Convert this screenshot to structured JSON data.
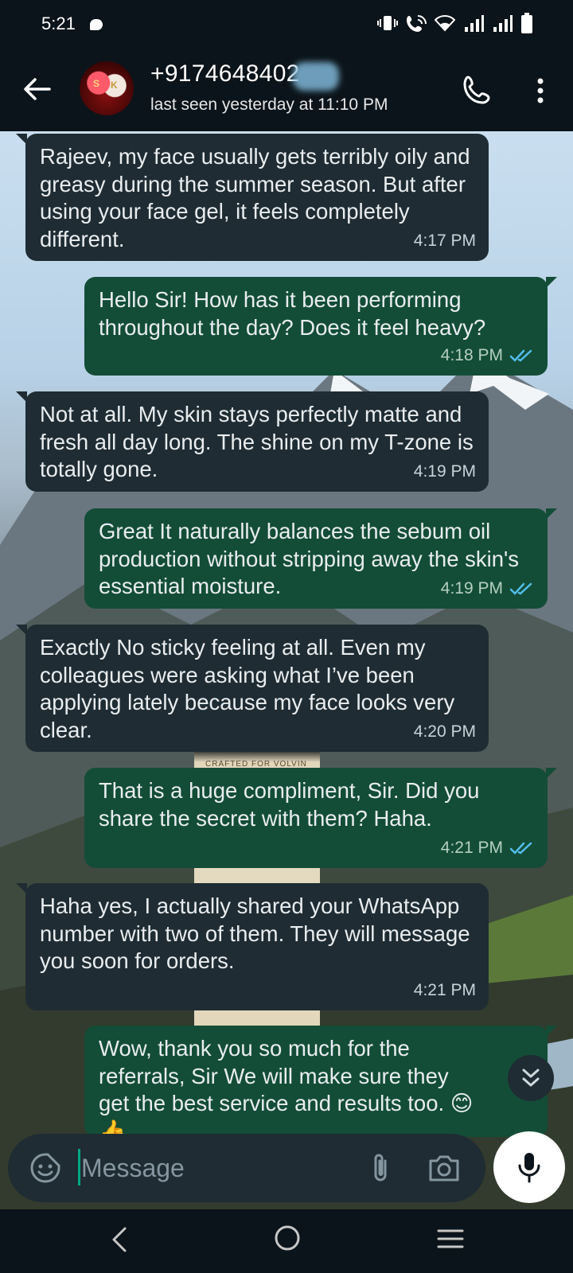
{
  "status_bar": {
    "time": "5:21"
  },
  "header": {
    "contact_name": "+9174648402",
    "last_seen": "last seen yesterday at 11:10 PM",
    "avatar_letters": [
      "S",
      "K"
    ]
  },
  "messages": [
    {
      "direction": "incoming",
      "text": "Rajeev, my face usually gets terribly oily and greasy during the summer season. But after using your face gel, it feels completely different.",
      "time": "4:17 PM"
    },
    {
      "direction": "outgoing",
      "text": "Hello Sir! How has it been performing throughout the day? Does it feel heavy?",
      "time": "4:18 PM",
      "status": "read"
    },
    {
      "direction": "incoming",
      "text": "Not at all. My skin stays perfectly matte and fresh all day long. The shine on my T-zone is totally gone.",
      "time": "4:19 PM"
    },
    {
      "direction": "outgoing",
      "text": "Great It naturally balances the sebum oil production without stripping away the skin's essential moisture.",
      "time": "4:19 PM",
      "status": "read"
    },
    {
      "direction": "incoming",
      "text": "Exactly No sticky feeling at all. Even my colleagues were asking what I’ve been applying lately because my face looks very clear.",
      "time": "4:20 PM"
    },
    {
      "direction": "outgoing",
      "text": "That is a huge compliment, Sir. Did you share the secret with them? Haha.",
      "time": "4:21 PM",
      "status": "read"
    },
    {
      "direction": "incoming",
      "text": "Haha yes, I actually shared your WhatsApp number with two of them. They will message you soon for orders.",
      "time": "4:21 PM"
    },
    {
      "direction": "outgoing",
      "text": "Wow, thank you so much for the referrals, Sir We will make sure they get the best service and results too. 😊 👍",
      "time": "",
      "status": ""
    }
  ],
  "wallpaper_text": "CRAFTED FOR VOLVIN",
  "composer": {
    "placeholder": "Message"
  },
  "colors": {
    "incoming_bubble": "#1f2c33",
    "outgoing_bubble": "#134d37",
    "read_ticks": "#53bdeb",
    "accent": "#00a884"
  },
  "icons": {
    "back": "arrow-left-icon",
    "call": "phone-icon",
    "more": "more-vertical-icon",
    "emoji": "sticker-smile-icon",
    "attach": "paperclip-icon",
    "camera": "camera-icon",
    "mic": "microphone-icon",
    "scroll_down": "double-chevron-down-icon"
  }
}
